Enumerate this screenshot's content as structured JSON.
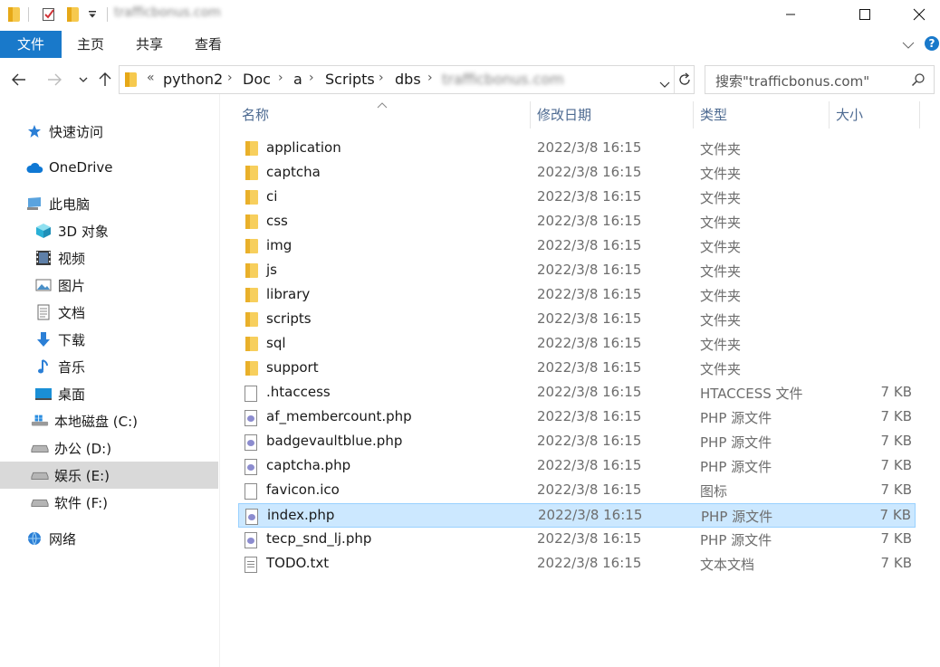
{
  "window": {
    "title": "trafficbonus.com"
  },
  "ribbon": {
    "tabs": [
      "文件",
      "主页",
      "共享",
      "查看"
    ]
  },
  "address": {
    "overflow": "«",
    "crumbs": [
      "python2",
      "Doc",
      "a",
      "Scripts",
      "dbs",
      "trafficbonus.com"
    ]
  },
  "search": {
    "placeholder": "搜索\"trafficbonus.com\""
  },
  "sidebar": {
    "items": [
      {
        "label": "快速访问",
        "icon": "star-icon"
      },
      {
        "label": "OneDrive",
        "icon": "cloud-icon"
      },
      {
        "label": "此电脑",
        "icon": "computer-icon"
      },
      {
        "label": "3D 对象",
        "icon": "cube-icon"
      },
      {
        "label": "视频",
        "icon": "film-icon"
      },
      {
        "label": "图片",
        "icon": "picture-icon"
      },
      {
        "label": "文档",
        "icon": "document-icon"
      },
      {
        "label": "下载",
        "icon": "download-icon"
      },
      {
        "label": "音乐",
        "icon": "music-icon"
      },
      {
        "label": "桌面",
        "icon": "desktop-icon"
      },
      {
        "label": "本地磁盘 (C:)",
        "icon": "windows-drive-icon"
      },
      {
        "label": "办公 (D:)",
        "icon": "drive-icon"
      },
      {
        "label": "娱乐 (E:)",
        "icon": "drive-icon"
      },
      {
        "label": "软件 (F:)",
        "icon": "drive-icon"
      },
      {
        "label": "网络",
        "icon": "network-icon"
      }
    ]
  },
  "columns": {
    "name": "名称",
    "modified": "修改日期",
    "type": "类型",
    "size": "大小"
  },
  "files": [
    {
      "name": "application",
      "date": "2022/3/8 16:15",
      "type": "文件夹",
      "size": "",
      "kind": "folder"
    },
    {
      "name": "captcha",
      "date": "2022/3/8 16:15",
      "type": "文件夹",
      "size": "",
      "kind": "folder"
    },
    {
      "name": "ci",
      "date": "2022/3/8 16:15",
      "type": "文件夹",
      "size": "",
      "kind": "folder"
    },
    {
      "name": "css",
      "date": "2022/3/8 16:15",
      "type": "文件夹",
      "size": "",
      "kind": "folder"
    },
    {
      "name": "img",
      "date": "2022/3/8 16:15",
      "type": "文件夹",
      "size": "",
      "kind": "folder"
    },
    {
      "name": "js",
      "date": "2022/3/8 16:15",
      "type": "文件夹",
      "size": "",
      "kind": "folder"
    },
    {
      "name": "library",
      "date": "2022/3/8 16:15",
      "type": "文件夹",
      "size": "",
      "kind": "folder"
    },
    {
      "name": "scripts",
      "date": "2022/3/8 16:15",
      "type": "文件夹",
      "size": "",
      "kind": "folder"
    },
    {
      "name": "sql",
      "date": "2022/3/8 16:15",
      "type": "文件夹",
      "size": "",
      "kind": "folder"
    },
    {
      "name": "support",
      "date": "2022/3/8 16:15",
      "type": "文件夹",
      "size": "",
      "kind": "folder"
    },
    {
      "name": ".htaccess",
      "date": "2022/3/8 16:15",
      "type": "HTACCESS 文件",
      "size": "7 KB",
      "kind": "file"
    },
    {
      "name": "af_membercount.php",
      "date": "2022/3/8 16:15",
      "type": "PHP 源文件",
      "size": "7 KB",
      "kind": "php"
    },
    {
      "name": "badgevaultblue.php",
      "date": "2022/3/8 16:15",
      "type": "PHP 源文件",
      "size": "7 KB",
      "kind": "php"
    },
    {
      "name": "captcha.php",
      "date": "2022/3/8 16:15",
      "type": "PHP 源文件",
      "size": "7 KB",
      "kind": "php"
    },
    {
      "name": "favicon.ico",
      "date": "2022/3/8 16:15",
      "type": "图标",
      "size": "7 KB",
      "kind": "file"
    },
    {
      "name": "index.php",
      "date": "2022/3/8 16:15",
      "type": "PHP 源文件",
      "size": "7 KB",
      "kind": "php",
      "selected": true
    },
    {
      "name": "tecp_snd_lj.php",
      "date": "2022/3/8 16:15",
      "type": "PHP 源文件",
      "size": "7 KB",
      "kind": "php"
    },
    {
      "name": "TODO.txt",
      "date": "2022/3/8 16:15",
      "type": "文本文档",
      "size": "7 KB",
      "kind": "txt"
    }
  ],
  "colors": {
    "accent": "#1979ca",
    "selection": "#cce8ff",
    "header_text": "#4d6a91"
  }
}
